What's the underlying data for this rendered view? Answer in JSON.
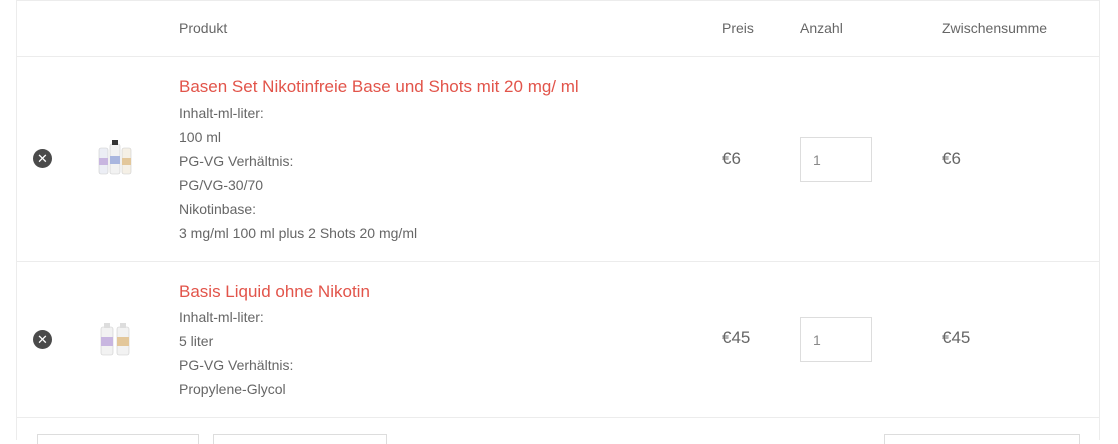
{
  "header": {
    "product": "Produkt",
    "price": "Preis",
    "quantity": "Anzahl",
    "subtotal": "Zwischensumme"
  },
  "items": [
    {
      "name": "Basen Set Nikotinfreie Base und Shots mit 20 mg/ ml",
      "meta": [
        "Inhalt-ml-liter:",
        "100 ml",
        "PG-VG Verhältnis:",
        "PG/VG-30/70",
        "Nikotinbase:",
        "3 mg/ml 100 ml plus 2 Shots 20 mg/ml"
      ],
      "price": "€6",
      "quantity": "1",
      "subtotal": "€6"
    },
    {
      "name": "Basis Liquid ohne Nikotin",
      "meta": [
        "Inhalt-ml-liter:",
        "5 liter",
        "PG-VG Verhältnis:",
        "Propylene-Glycol"
      ],
      "price": "€45",
      "quantity": "1",
      "subtotal": "€45"
    }
  ],
  "colors": {
    "link": "#e2544a",
    "border": "#ececec",
    "remove_bg": "#4a4a4a"
  },
  "icons": {
    "remove": "close-circle-icon",
    "product": "bottle-product-image"
  }
}
